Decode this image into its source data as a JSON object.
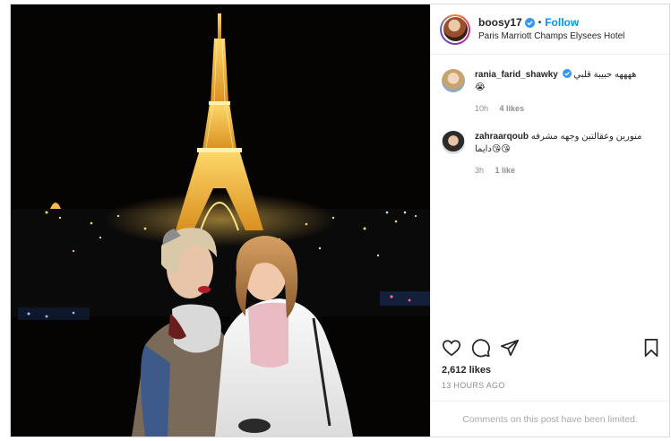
{
  "header": {
    "username": "boosy17",
    "separator": "•",
    "follow_label": "Follow",
    "location": "Paris Marriott Champs Elysees Hotel"
  },
  "comments": [
    {
      "username": "rania_farid_shawky",
      "verified": true,
      "text": "ههههه حبيبة قلبي",
      "emoji": "😭",
      "time": "10h",
      "likes": "4 likes"
    },
    {
      "username": "zahraarqoub",
      "verified": false,
      "text": "منورين وعقالتين وجهه مشرفه",
      "emoji": "😘😘دايما",
      "time": "3h",
      "likes": "1 like"
    }
  ],
  "stats": {
    "likes": "2,612 likes",
    "time_ago": "13 HOURS AGO"
  },
  "footer": {
    "limited_text": "Comments on this post have been limited."
  },
  "icons": {
    "like": "heart-icon",
    "comment": "comment-icon",
    "share": "paper-plane-icon",
    "save": "bookmark-icon",
    "verified": "verified-badge-icon"
  },
  "colors": {
    "accent": "#0095f6",
    "verified": "#3897f0",
    "muted": "#8e8e8e"
  }
}
